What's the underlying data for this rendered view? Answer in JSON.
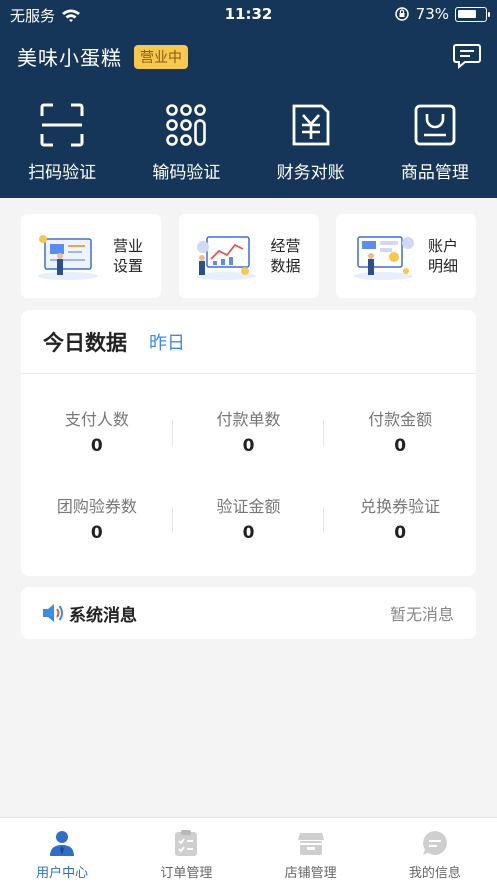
{
  "status_bar": {
    "carrier": "无服务",
    "time": "11:32",
    "battery_percent": "73%",
    "battery_level": 0.73
  },
  "shop": {
    "name": "美味小蛋糕",
    "status_badge": "营业中"
  },
  "quick_actions": [
    {
      "label": "扫码验证",
      "icon": "scan-icon"
    },
    {
      "label": "输码验证",
      "icon": "keypad-icon"
    },
    {
      "label": "财务对账",
      "icon": "finance-icon"
    },
    {
      "label": "商品管理",
      "icon": "product-icon"
    }
  ],
  "function_cards": [
    {
      "label": "营业设置",
      "icon": "business-settings-illustration"
    },
    {
      "label": "经营数据",
      "icon": "operation-data-illustration"
    },
    {
      "label": "账户明细",
      "icon": "account-detail-illustration"
    }
  ],
  "today_data": {
    "title": "今日数据",
    "tab_yesterday": "昨日",
    "rows": [
      [
        {
          "label": "支付人数",
          "value": "0"
        },
        {
          "label": "付款单数",
          "value": "0"
        },
        {
          "label": "付款金额",
          "value": "0"
        }
      ],
      [
        {
          "label": "团购验券数",
          "value": "0"
        },
        {
          "label": "验证金额",
          "value": "0"
        },
        {
          "label": "兑换券验证",
          "value": "0"
        }
      ]
    ]
  },
  "notice": {
    "title": "系统消息",
    "status": "暂无消息",
    "icon": "speaker-icon"
  },
  "tabbar": [
    {
      "label": "用户中心",
      "icon": "user-icon",
      "active": true
    },
    {
      "label": "订单管理",
      "icon": "order-icon",
      "active": false
    },
    {
      "label": "店铺管理",
      "icon": "store-icon",
      "active": false
    },
    {
      "label": "我的信息",
      "icon": "message-icon",
      "active": false
    }
  ],
  "colors": {
    "header_bg": "#163659",
    "accent_blue": "#3d8be8",
    "badge_bg": "#f6c850",
    "tab_active": "#2f6fc7",
    "tab_inactive": "#cfcfcf"
  }
}
